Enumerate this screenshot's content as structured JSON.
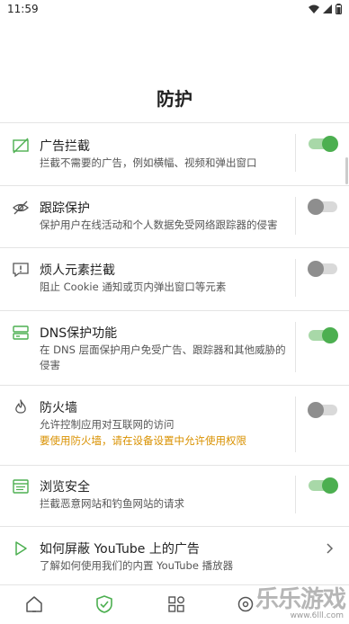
{
  "status_bar": {
    "time": "11:59"
  },
  "page": {
    "title": "防护"
  },
  "rows": [
    {
      "title": "广告拦截",
      "desc": "拦截不需要的广告，例如横幅、视频和弹出窗口",
      "toggle": "on"
    },
    {
      "title": "跟踪保护",
      "desc": "保护用户在线活动和个人数据免受网络跟踪器的侵害",
      "toggle": "off"
    },
    {
      "title": "烦人元素拦截",
      "desc": "阻止 Cookie 通知或页内弹出窗口等元素",
      "toggle": "off"
    },
    {
      "title": "DNS保护功能",
      "desc": "在 DNS 层面保护用户免受广告、跟踪器和其他威胁的侵害",
      "toggle": "on"
    },
    {
      "title": "防火墙",
      "desc": "允许控制应用对互联网的访问",
      "warning": "要使用防火墙，请在设备设置中允许使用权限",
      "toggle": "off"
    },
    {
      "title": "浏览安全",
      "desc": "拦截恶意网站和钓鱼网站的请求",
      "toggle": "on"
    },
    {
      "title": "如何屏蔽 YouTube 上的广告",
      "desc": "了解如何使用我们的内置 YouTube 播放器"
    }
  ],
  "icons": {
    "ad_block": "ad-block-icon",
    "tracking": "eye-slash-icon",
    "annoyance": "alert-bubble-icon",
    "dns": "server-icon",
    "firewall": "flame-icon",
    "browsing": "browser-window-icon",
    "youtube": "play-icon"
  },
  "nav": [
    "home-icon",
    "shield-icon",
    "apps-icon",
    "settings-icon"
  ],
  "colors": {
    "accent": "#4caf50",
    "warning": "#d99100"
  },
  "watermark": {
    "text": "乐乐游戏",
    "sub": "www.6lll.com"
  }
}
